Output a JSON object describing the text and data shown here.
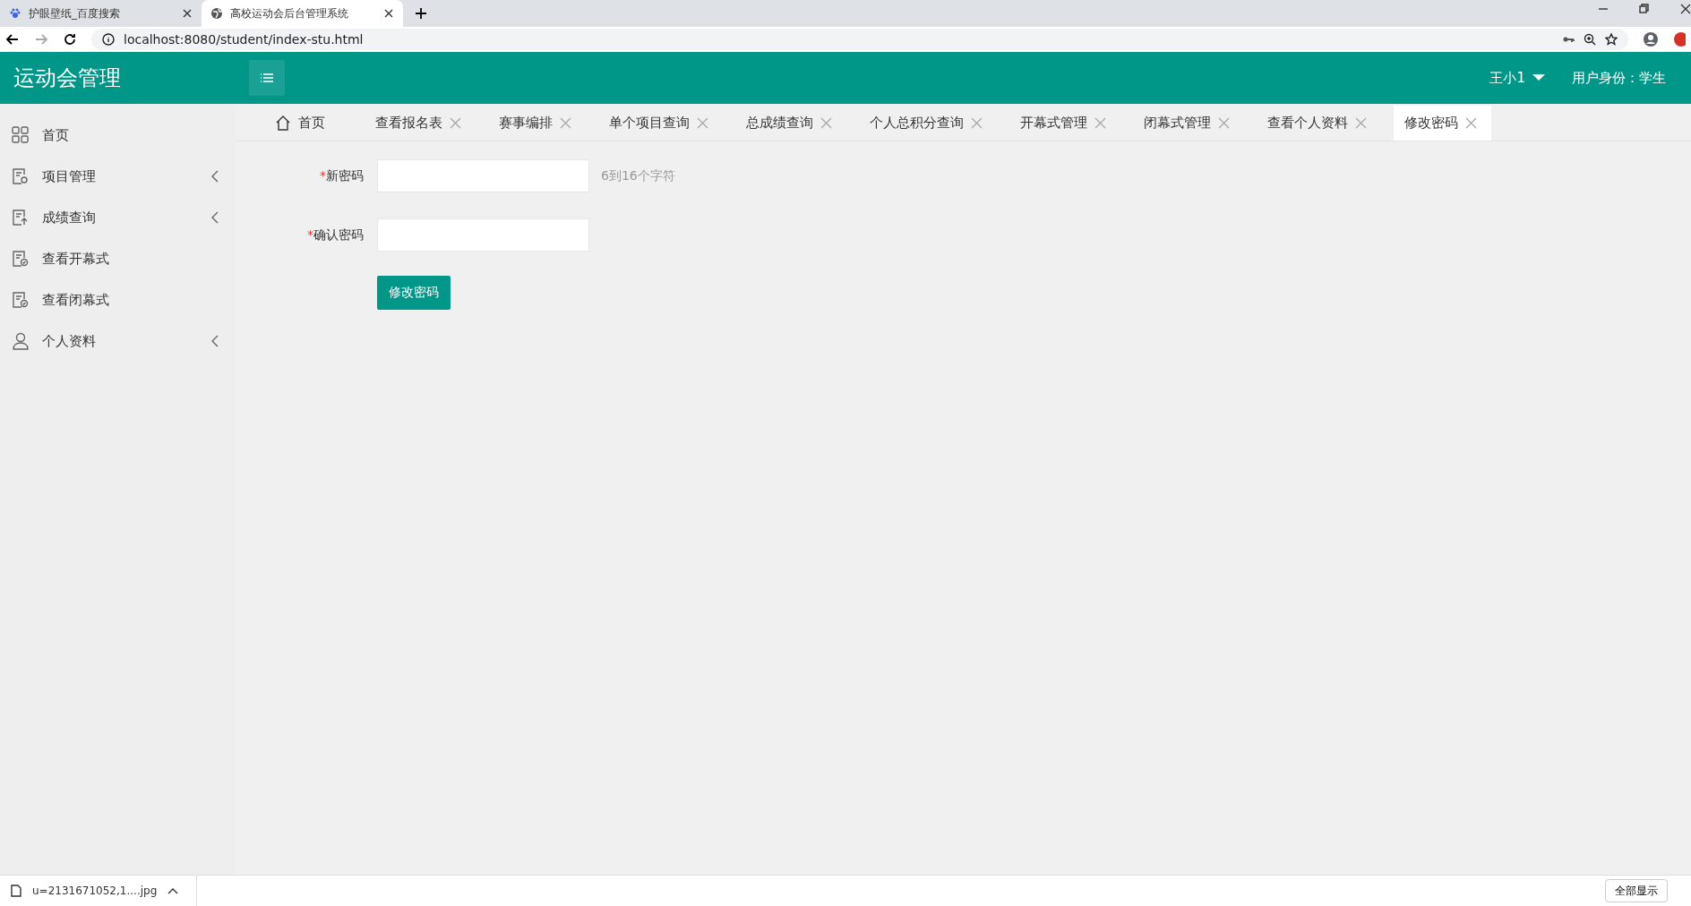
{
  "browser": {
    "tabs": [
      {
        "title": "护眼壁纸_百度搜索",
        "selected": false
      },
      {
        "title": "高校运动会后台管理系统",
        "selected": true
      }
    ],
    "url": "localhost:8080/student/index-stu.html"
  },
  "header": {
    "brand": "运动会管理",
    "user": "王小1",
    "role": "用户身份：学生"
  },
  "sidebar": {
    "items": [
      {
        "label": "首页",
        "kind": "grid",
        "expandable": false
      },
      {
        "label": "项目管理",
        "kind": "settings",
        "expandable": true
      },
      {
        "label": "成绩查询",
        "kind": "upload",
        "expandable": true
      },
      {
        "label": "查看开幕式",
        "kind": "check",
        "expandable": false
      },
      {
        "label": "查看闭幕式",
        "kind": "check",
        "expandable": false
      },
      {
        "label": "个人资料",
        "kind": "person",
        "expandable": true
      }
    ]
  },
  "page_tabs": [
    {
      "label": "首页",
      "kind": "home",
      "selected": false
    },
    {
      "label": "查看报名表",
      "kind": "page",
      "selected": false
    },
    {
      "label": "赛事编排",
      "kind": "page",
      "selected": false
    },
    {
      "label": "单个项目查询",
      "kind": "page",
      "selected": false
    },
    {
      "label": "总成绩查询",
      "kind": "page",
      "selected": false
    },
    {
      "label": "个人总积分查询",
      "kind": "page",
      "selected": false
    },
    {
      "label": "开幕式管理",
      "kind": "page",
      "selected": false
    },
    {
      "label": "闭幕式管理",
      "kind": "page",
      "selected": false
    },
    {
      "label": "查看个人资料",
      "kind": "page",
      "selected": false
    },
    {
      "label": "修改密码",
      "kind": "page",
      "selected": true
    }
  ],
  "form": {
    "fields": [
      {
        "label": "新密码",
        "required": true,
        "required_mark": "*",
        "hint": "6到16个字符"
      },
      {
        "label": "确认密码",
        "required": true,
        "required_mark": "*"
      }
    ],
    "submit": "修改密码"
  },
  "download_bar": {
    "file": "u=2131671052,1....jpg",
    "show_all": "全部显示"
  }
}
